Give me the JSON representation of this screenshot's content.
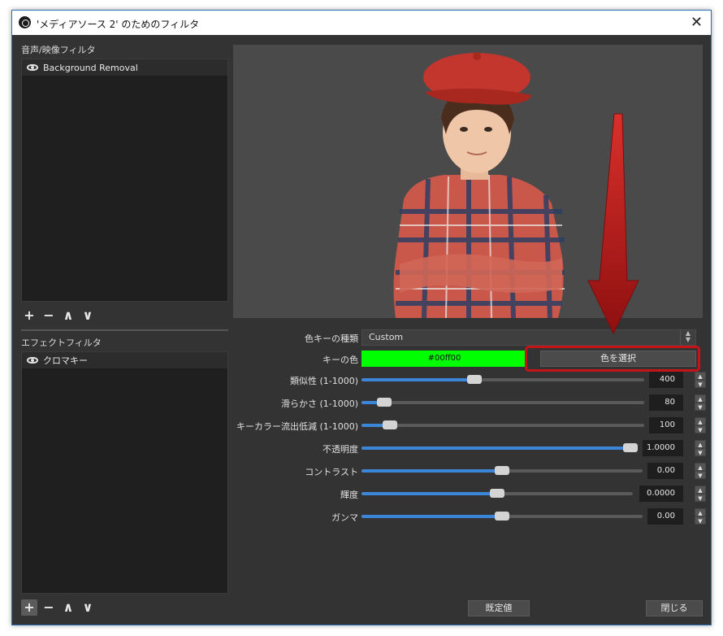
{
  "window": {
    "title": "'メディアソース 2' のためのフィルタ",
    "close_symbol": "✕"
  },
  "av_filters": {
    "label": "音声/映像フィルタ",
    "items": [
      {
        "name": "Background Removal"
      }
    ]
  },
  "effect_filters": {
    "label": "エフェクトフィルタ",
    "items": [
      {
        "name": "クロマキー"
      }
    ]
  },
  "toolbar": {
    "add": "+",
    "remove": "−",
    "up": "∧",
    "down": "∨"
  },
  "settings": {
    "key_type": {
      "label": "色キーの種類",
      "value": "Custom"
    },
    "key_color": {
      "label": "キーの色",
      "value": "#00ff00",
      "color": "#00ff00",
      "pick_label": "色を選択"
    },
    "similarity": {
      "label": "類似性 (1-1000)",
      "value": "400",
      "fraction": 0.4
    },
    "smoothness": {
      "label": "滑らかさ (1-1000)",
      "value": "80",
      "fraction": 0.08
    },
    "spill": {
      "label": "キーカラー流出低減 (1-1000)",
      "value": "100",
      "fraction": 0.1
    },
    "opacity": {
      "label": "不透明度",
      "value": "1.0000",
      "fraction": 1.0
    },
    "contrast": {
      "label": "コントラスト",
      "value": "0.00",
      "fraction": 0.5
    },
    "brightness": {
      "label": "輝度",
      "value": "0.0000",
      "fraction": 0.5
    },
    "gamma": {
      "label": "ガンマ",
      "value": "0.00",
      "fraction": 0.5
    }
  },
  "footer": {
    "defaults_label": "既定値",
    "close_label": "閉じる"
  },
  "colors": {
    "accent": "#3b86d8",
    "highlight": "#c4141a",
    "arrow": "#b51a1a"
  }
}
